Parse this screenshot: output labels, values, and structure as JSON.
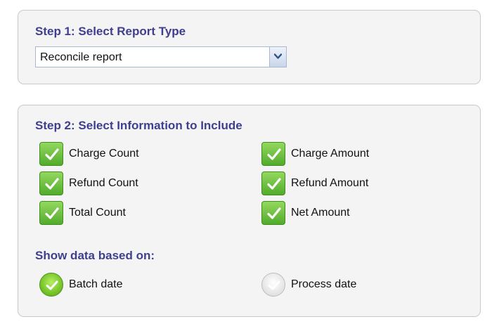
{
  "step1": {
    "title": "Step 1: Select Report Type",
    "report_type": {
      "selected": "Reconcile report"
    }
  },
  "step2": {
    "title": "Step 2: Select Information to Include",
    "options": [
      {
        "label": "Charge Count",
        "checked": true
      },
      {
        "label": "Charge Amount",
        "checked": true
      },
      {
        "label": "Refund Count",
        "checked": true
      },
      {
        "label": "Refund Amount",
        "checked": true
      },
      {
        "label": "Total Count",
        "checked": true
      },
      {
        "label": "Net Amount",
        "checked": true
      }
    ],
    "data_based_on": {
      "title": "Show data based on:",
      "choices": [
        {
          "label": "Batch date",
          "selected": true
        },
        {
          "label": "Process date",
          "selected": false
        }
      ]
    }
  },
  "colors": {
    "title": "#3f3f8f",
    "check_green": "#52ab2c",
    "radio_green": "#6cbd22",
    "radio_off": "#e2e2e2"
  }
}
